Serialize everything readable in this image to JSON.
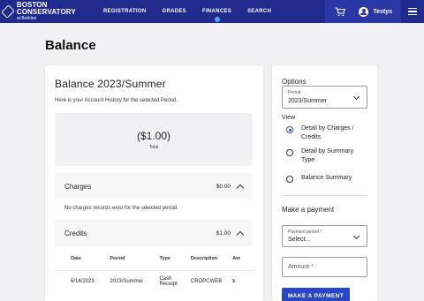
{
  "header": {
    "brand_name": "BOSTON CONSERVATORY",
    "brand_sub": "at Berklee",
    "nav": [
      "REGISTRATION",
      "GRADES",
      "FINANCES",
      "SEARCH"
    ],
    "active_nav": "FINANCES",
    "user_name": "Testys",
    "icons": [
      "cart-icon",
      "user-avatar-icon",
      "menu-icon"
    ],
    "colors": {
      "nav_bg": "#1f2a8c",
      "active_indicator": "#4ea3ff",
      "accent": "#2a47c4"
    }
  },
  "page": {
    "title": "Balance"
  },
  "balance": {
    "title": "Balance 2023/Summer",
    "description": "Here is your Account History for the selected Period.",
    "total_amount": "($1.00)",
    "total_label": "Total",
    "charges": {
      "label": "Charges",
      "amount": "$0.00",
      "empty_message": "No charges records exist for the selected period."
    },
    "credits": {
      "label": "Credits",
      "amount": "$1.00",
      "columns": [
        "Date",
        "Period",
        "Type",
        "Description",
        "Am"
      ],
      "rows": [
        {
          "date": "6/14/2023",
          "period": "2023/Summer",
          "type_line1": "Cash",
          "type_line2": "Receipt",
          "description": "CROPCWEB",
          "amount": "$"
        }
      ]
    }
  },
  "options": {
    "title": "Options",
    "period_label": "Period",
    "period_value": "2023/Summer",
    "view_label": "View",
    "view_options": [
      "Detail by Charges / Credits",
      "Detail by Summary Type",
      "Balance Summary"
    ],
    "selected_view": "Detail by Charges / Credits"
  },
  "payment": {
    "title": "Make a payment",
    "period_label": "Payment period *",
    "period_value": "Select...",
    "amount_placeholder": "Amount *",
    "button_label": "MAKE A PAYMENT"
  }
}
